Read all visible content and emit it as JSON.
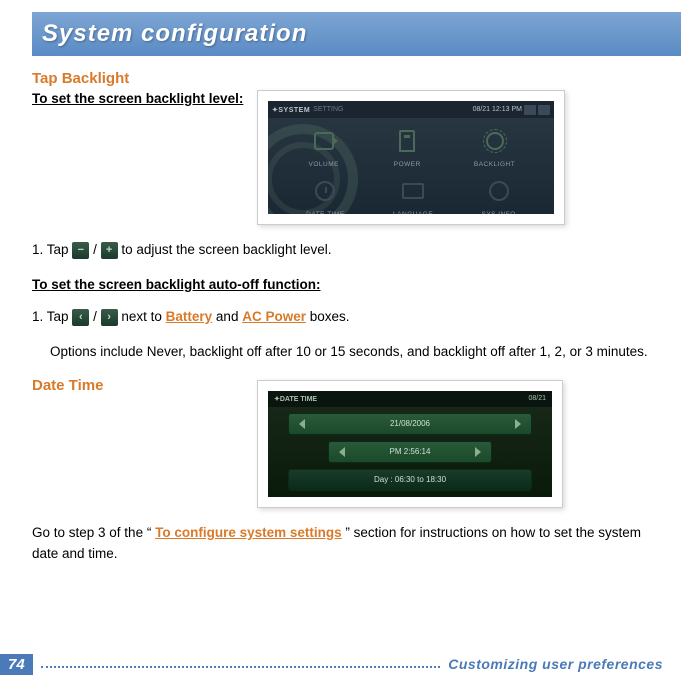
{
  "header": {
    "title": "System configuration"
  },
  "section_backlight": {
    "title": "Tap Backlight",
    "sub1": "To set the screen backlight level: ",
    "step1_pre": "1. Tap ",
    "step1_mid": " / ",
    "step1_post": " to adjust the screen backlight level.",
    "sub2": "To set the screen backlight auto-off function: ",
    "step2_pre": "1. Tap ",
    "step2_mid": " / ",
    "step2_next": " next to ",
    "step2_and": " and ",
    "step2_boxes": " boxes.",
    "battery": "Battery",
    "acpower": "AC Power",
    "options": "Options include Never, backlight off after 10 or 15 seconds, and backlight off after 1, 2, or 3 minutes."
  },
  "section_datetime": {
    "title": "Date Time",
    "text_pre": "Go to step 3 of the “",
    "link": "To configure system settings",
    "text_post": "” section for instructions on how to set the system date and time."
  },
  "screenshot_system": {
    "topbar_label": "SYSTEM",
    "topbar_sub": "SETTING",
    "time": "08/21  12:13 PM",
    "tiles_row1": [
      "VOLUME",
      "POWER",
      "BACKLIGHT"
    ],
    "tiles_row2": [
      "DATE TIME",
      "LANGUAGE",
      "SYS INFO"
    ]
  },
  "screenshot_datetime": {
    "topbar_label": "DATE TIME",
    "time": "08/21",
    "field_date": "21/08/2006",
    "field_time": "PM 2:56:14",
    "field_day": "Day : 06:30 to 18:30"
  },
  "icons": {
    "plus": "+",
    "minus": "−",
    "left": "‹",
    "right": "›"
  },
  "footer": {
    "page": "74",
    "label": "Customizing user preferences"
  }
}
